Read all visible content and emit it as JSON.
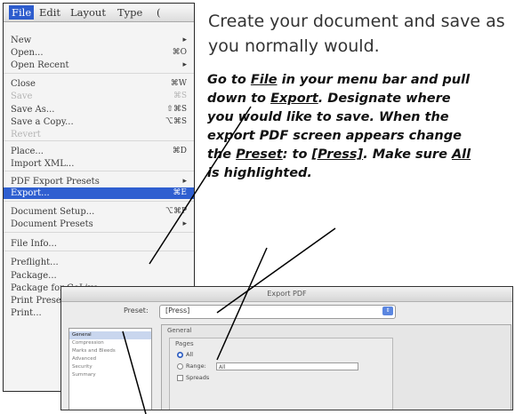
{
  "menubar": {
    "items": [
      "File",
      "Edit",
      "Layout",
      "Type",
      "("
    ],
    "active": "File"
  },
  "file_menu": {
    "items": [
      {
        "label": "New",
        "shortcut": "▸",
        "disabled": false
      },
      {
        "label": "Open...",
        "shortcut": "⌘O",
        "disabled": false
      },
      {
        "label": "Open Recent",
        "shortcut": "▸",
        "disabled": false
      },
      {
        "label": "Close",
        "shortcut": "⌘W",
        "disabled": false
      },
      {
        "label": "Save",
        "shortcut": "⌘S",
        "disabled": true
      },
      {
        "label": "Save As...",
        "shortcut": "⇧⌘S",
        "disabled": false
      },
      {
        "label": "Save a Copy...",
        "shortcut": "⌥⌘S",
        "disabled": false
      },
      {
        "label": "Revert",
        "shortcut": "",
        "disabled": true
      },
      {
        "label": "Place...",
        "shortcut": "⌘D",
        "disabled": false
      },
      {
        "label": "Import XML...",
        "shortcut": "",
        "disabled": false
      },
      {
        "label": "PDF Export Presets",
        "shortcut": "▸",
        "disabled": false
      },
      {
        "label": "Export...",
        "shortcut": "⌘E",
        "disabled": false,
        "highlighted": true
      },
      {
        "label": "Document Setup...",
        "shortcut": "⌥⌘P",
        "disabled": false
      },
      {
        "label": "Document Presets",
        "shortcut": "▸",
        "disabled": false
      },
      {
        "label": "File Info...",
        "shortcut": "",
        "disabled": false
      },
      {
        "label": "Preflight...",
        "shortcut": "",
        "disabled": false
      },
      {
        "label": "Package...",
        "shortcut": "",
        "disabled": false
      },
      {
        "label": "Package for GoLive...",
        "shortcut": "",
        "disabled": false
      },
      {
        "label": "Print Presets",
        "shortcut": "",
        "disabled": false
      },
      {
        "label": "Print...",
        "shortcut": "",
        "disabled": false
      }
    ]
  },
  "instructions": {
    "intro": "Create your document and save as you normally would.",
    "steps": {
      "p1": "Go to ",
      "file": "File",
      "p2": " in your menu bar and pull down to ",
      "export": "Export",
      "p3": ". Designate where you would like to save. When the export PDF screen appears change the ",
      "preset": "Preset",
      "p4": ": to ",
      "press": "[Press]",
      "p5": ". Make sure ",
      "all": "All",
      "p6": " is highlighted."
    }
  },
  "dialog": {
    "title": "Export PDF",
    "preset_label": "Preset:",
    "preset_value": "[Press]",
    "categories": [
      "General",
      "Compression",
      "Marks and Bleeds",
      "Advanced",
      "Security",
      "Summary"
    ],
    "selected_category": "General",
    "section_title": "General",
    "pages_label": "Pages",
    "all_label": "All",
    "range_label": "Range:",
    "range_value": "All",
    "spreads_label": "Spreads"
  },
  "colors": {
    "highlight": "#2f5fd0",
    "dialog_bg": "#ececec"
  }
}
